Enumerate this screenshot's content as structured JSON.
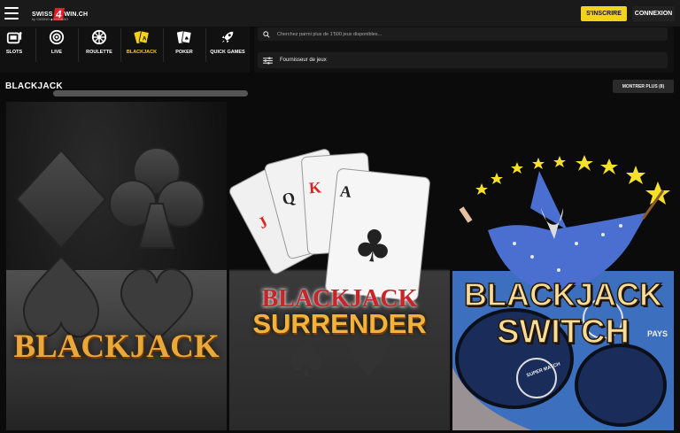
{
  "header": {
    "logo_left": "SWISS",
    "logo_num": "4",
    "logo_right": "WIN.CH",
    "logo_sub": "by CASINO ◆ LUGANO",
    "signup_label": "S'INSCRIRE",
    "login_label": "CONNEXION"
  },
  "categories": [
    {
      "label": "SLOTS",
      "icon": "slot-machine-icon"
    },
    {
      "label": "LIVE",
      "icon": "roulette-wheel-icon"
    },
    {
      "label": "ROULETTE",
      "icon": "roulette-icon"
    },
    {
      "label": "BLACKJACK",
      "icon": "blackjack-cards-icon",
      "active": true
    },
    {
      "label": "POKER",
      "icon": "poker-cards-icon"
    },
    {
      "label": "QUICK GAMES",
      "icon": "rocket-icon"
    }
  ],
  "search": {
    "placeholder": "Cherchez parmi plus de 1'500 jeux disponibles..."
  },
  "provider_filter": {
    "label": "Fournisseur de jeux"
  },
  "section": {
    "title": "BLACKJACK",
    "show_more_label": "MONTRER PLUS (8)"
  },
  "games": [
    {
      "title_line1": "BLACKJACK",
      "title_line2": ""
    },
    {
      "title_line1": "BLACKJACK",
      "title_line2": "SURRENDER"
    },
    {
      "title_line1": "BLACKJACK",
      "title_line2": "SWITCH",
      "badge_pays": "PAYS",
      "badge_super": "SUPER MATCH"
    }
  ],
  "colors": {
    "accent": "#f5d21a",
    "background": "#0b0b0b",
    "brand_red": "#e41e26"
  }
}
